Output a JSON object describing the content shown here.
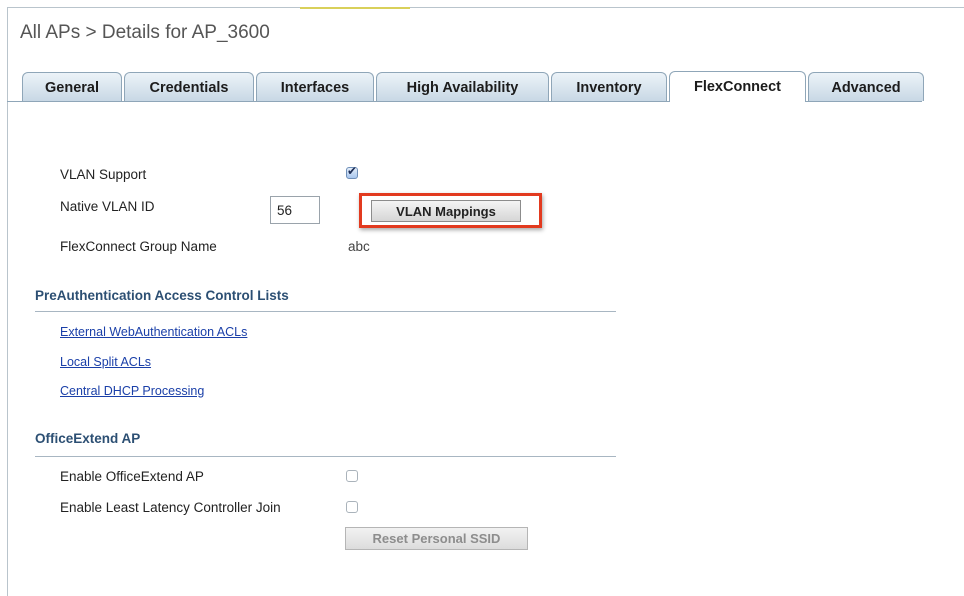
{
  "breadcrumb": "All APs > Details for AP_3600",
  "tabs": [
    {
      "label": "General"
    },
    {
      "label": "Credentials"
    },
    {
      "label": "Interfaces"
    },
    {
      "label": "High Availability"
    },
    {
      "label": "Inventory"
    },
    {
      "label": "FlexConnect",
      "active": true
    },
    {
      "label": "Advanced"
    }
  ],
  "flexconnect": {
    "vlan_support_label": "VLAN Support",
    "vlan_support_checked": true,
    "native_vlan_label": "Native VLAN ID",
    "native_vlan_value": "56",
    "vlan_mappings_button": "VLAN Mappings",
    "group_name_label": "FlexConnect Group Name",
    "group_name_value": "abc"
  },
  "preauth": {
    "title": "PreAuthentication Access Control Lists",
    "links": [
      "External WebAuthentication ACLs",
      "Local Split ACLs",
      "Central DHCP Processing"
    ]
  },
  "officeextend": {
    "title": "OfficeExtend AP",
    "enable_label": "Enable OfficeExtend AP",
    "enable_checked": false,
    "least_latency_label": "Enable Least Latency Controller Join",
    "least_latency_checked": false,
    "reset_button": "Reset Personal SSID"
  },
  "colors": {
    "highlight": "#e23a1f",
    "section_title": "#2c4f73",
    "link": "#1a3fa8"
  }
}
